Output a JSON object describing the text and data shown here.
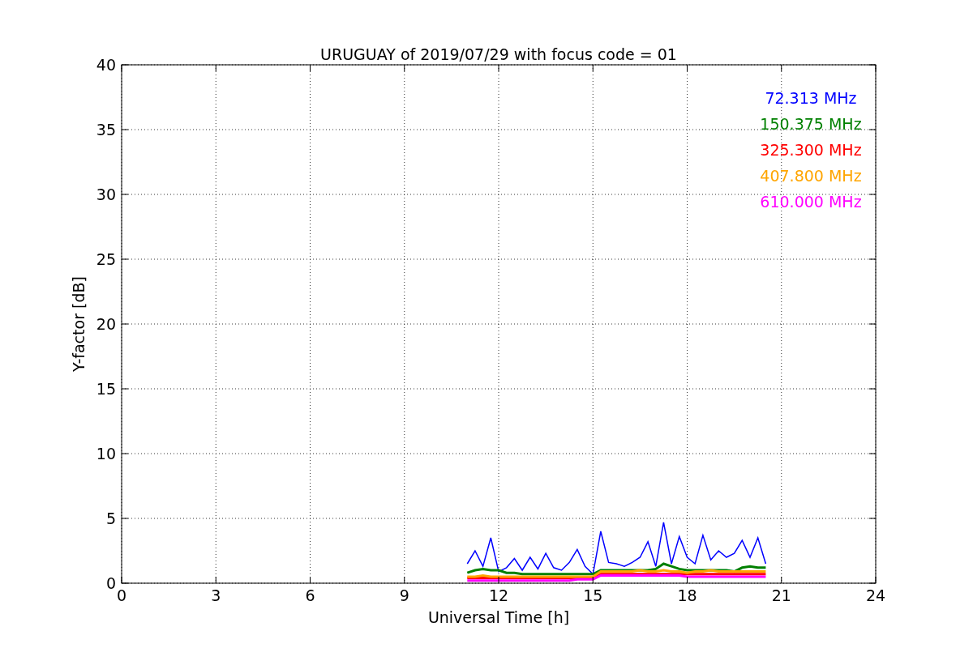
{
  "figure": {
    "chart_data": {
      "type": "line",
      "title": "URUGUAY of 2019/07/29 with focus code = 01",
      "xlabel": "Universal Time [h]",
      "ylabel": "Y-factor [dB]",
      "x": [
        11,
        11.25,
        11.5,
        11.75,
        12,
        12.25,
        12.5,
        12.75,
        13,
        13.25,
        13.5,
        13.75,
        14,
        14.25,
        14.5,
        14.75,
        15,
        15.25,
        15.5,
        15.75,
        16,
        16.25,
        16.5,
        16.75,
        17,
        17.25,
        17.5,
        17.75,
        18,
        18.25,
        18.5,
        18.75,
        19,
        19.25,
        19.5,
        19.75,
        20,
        20.25,
        20.5
      ],
      "series": [
        {
          "name": "72.313 MHz",
          "color": "#0000ff",
          "values": [
            1.5,
            2.5,
            1.3,
            3.5,
            0.9,
            1.2,
            1.9,
            1.0,
            2.0,
            1.1,
            2.3,
            1.2,
            1.0,
            1.6,
            2.6,
            1.3,
            0.7,
            4.0,
            1.6,
            1.5,
            1.3,
            1.6,
            2.0,
            3.2,
            1.3,
            4.7,
            1.5,
            3.6,
            2.0,
            1.5,
            3.7,
            1.8,
            2.5,
            2.0,
            2.3,
            3.3,
            2.0,
            3.5,
            1.5
          ]
        },
        {
          "name": "150.375 MHz",
          "color": "#008000",
          "values": [
            0.8,
            1.0,
            1.1,
            1.0,
            1.0,
            0.8,
            0.8,
            0.7,
            0.7,
            0.7,
            0.7,
            0.7,
            0.7,
            0.7,
            0.7,
            0.7,
            0.7,
            1.0,
            1.0,
            1.0,
            1.0,
            1.0,
            1.0,
            1.0,
            1.1,
            1.5,
            1.3,
            1.1,
            1.0,
            1.0,
            1.0,
            1.0,
            1.0,
            1.0,
            0.9,
            1.2,
            1.3,
            1.2,
            1.2
          ]
        },
        {
          "name": "325.300 MHz",
          "color": "#ff0000",
          "values": [
            0.4,
            0.4,
            0.4,
            0.4,
            0.4,
            0.4,
            0.4,
            0.4,
            0.4,
            0.4,
            0.4,
            0.4,
            0.4,
            0.4,
            0.4,
            0.4,
            0.4,
            0.7,
            0.7,
            0.7,
            0.7,
            0.7,
            0.7,
            0.7,
            0.7,
            0.7,
            0.7,
            0.7,
            0.7,
            0.7,
            0.7,
            0.7,
            0.7,
            0.7,
            0.7,
            0.7,
            0.7,
            0.7,
            0.7
          ]
        },
        {
          "name": "407.800 MHz",
          "color": "#ffa500",
          "values": [
            0.5,
            0.5,
            0.6,
            0.5,
            0.5,
            0.5,
            0.5,
            0.5,
            0.5,
            0.5,
            0.5,
            0.5,
            0.5,
            0.5,
            0.5,
            0.5,
            0.5,
            0.9,
            0.9,
            0.9,
            0.9,
            0.9,
            1.0,
            0.9,
            0.9,
            1.0,
            0.9,
            0.9,
            0.8,
            0.9,
            0.9,
            1.0,
            0.9,
            0.9,
            0.9,
            0.9,
            0.9,
            0.9,
            0.9
          ]
        },
        {
          "name": "610.000 MHz",
          "color": "#ff00ff",
          "values": [
            0.2,
            0.2,
            0.2,
            0.2,
            0.2,
            0.2,
            0.2,
            0.2,
            0.2,
            0.2,
            0.2,
            0.2,
            0.2,
            0.2,
            0.3,
            0.3,
            0.3,
            0.6,
            0.6,
            0.6,
            0.6,
            0.6,
            0.6,
            0.6,
            0.6,
            0.6,
            0.6,
            0.6,
            0.5,
            0.5,
            0.5,
            0.5,
            0.5,
            0.5,
            0.5,
            0.5,
            0.5,
            0.5,
            0.5
          ]
        }
      ],
      "xlim": [
        0,
        24
      ],
      "ylim": [
        0,
        40
      ],
      "xticks": [
        0,
        3,
        6,
        9,
        12,
        15,
        18,
        21,
        24
      ],
      "yticks": [
        0,
        5,
        10,
        15,
        20,
        25,
        30,
        35,
        40
      ],
      "grid": true
    }
  }
}
